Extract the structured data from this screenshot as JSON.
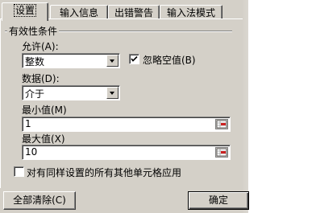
{
  "tabs": [
    {
      "label": "设置",
      "active": true
    },
    {
      "label": "输入信息",
      "active": false
    },
    {
      "label": "出错警告",
      "active": false
    },
    {
      "label": "输入法模式",
      "active": false
    }
  ],
  "group": {
    "title": "有效性条件"
  },
  "allow": {
    "label": "允许(A):",
    "value": "整数"
  },
  "ignore_blank": {
    "label": "忽略空值(B)",
    "checked": true
  },
  "data": {
    "label": "数据(D):",
    "value": "介于"
  },
  "minimum": {
    "label": "最小值(M)",
    "value": "1"
  },
  "maximum": {
    "label": "最大值(X)",
    "value": "10"
  },
  "apply_all": {
    "label": "对有同样设置的所有其他单元格应用",
    "checked": false
  },
  "buttons": {
    "clear_all": "全部清除(C)",
    "ok": "确定"
  },
  "colors": {
    "dialog_face": "#d4d0c8",
    "field_bg": "#ffffff"
  },
  "icons": {
    "range_selector": "collapse-dialog-icon",
    "check": "checkmark-icon",
    "dropdown": "chevron-down-icon"
  }
}
